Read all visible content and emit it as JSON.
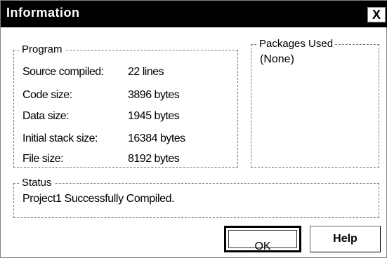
{
  "window": {
    "title": "Information",
    "close_glyph": "X"
  },
  "program": {
    "title": "Program",
    "rows": [
      {
        "label": "Source compiled:",
        "value": "22 lines"
      },
      {
        "label": "Code size:",
        "value": "3896 bytes"
      },
      {
        "label": "Data size:",
        "value": "1945 bytes"
      },
      {
        "label": "Initial stack size:",
        "value": "16384 bytes"
      },
      {
        "label": "File size:",
        "value": "8192 bytes"
      }
    ]
  },
  "packages": {
    "title": "Packages Used",
    "value": "(None)"
  },
  "status": {
    "title": "Status",
    "message": "Project1 Successfully Compiled."
  },
  "buttons": {
    "ok": "OK",
    "help": "Help"
  }
}
